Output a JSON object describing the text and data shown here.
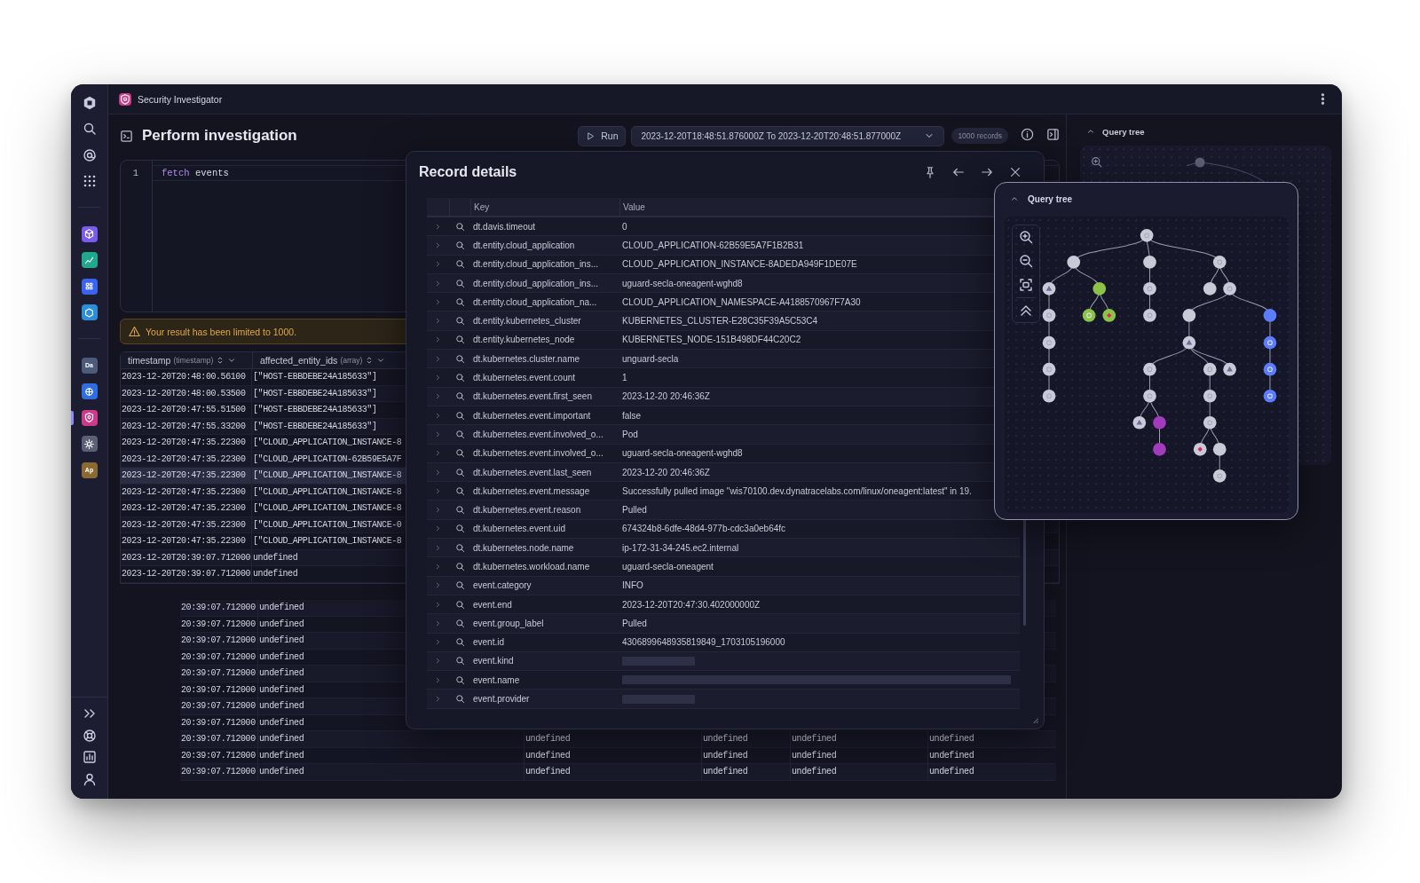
{
  "app": {
    "title": "Security Investigator"
  },
  "nav": {
    "top": [
      {
        "kind": "logo",
        "selected": false
      },
      {
        "kind": "search",
        "selected": false
      },
      {
        "kind": "at",
        "selected": false
      },
      {
        "kind": "grid",
        "selected": false
      }
    ],
    "apps": [
      {
        "kind": "cube",
        "color": "#7a5cf0",
        "selected": false
      },
      {
        "kind": "chart",
        "color": "#1fa88c",
        "selected": false
      },
      {
        "kind": "tiles",
        "color": "#3b63f0",
        "selected": false
      },
      {
        "kind": "hexagon",
        "color": "#2a8fd8",
        "selected": false
      }
    ],
    "pinned": [
      {
        "kind": "label",
        "label": "Da",
        "color": "#4d5b7a",
        "selected": false
      },
      {
        "kind": "wheel",
        "color": "#2f6de0",
        "selected": false
      },
      {
        "kind": "shield",
        "color": "#d0388a",
        "selected": true
      },
      {
        "kind": "gear",
        "color": "#5c5f78",
        "selected": false
      },
      {
        "kind": "label",
        "label": "Ap",
        "color": "#8a6a30",
        "selected": false
      }
    ],
    "bottom": [
      {
        "kind": "expand",
        "selected": false
      },
      {
        "kind": "lifebuoy",
        "selected": false
      },
      {
        "kind": "report",
        "selected": false
      },
      {
        "kind": "user",
        "selected": false
      }
    ]
  },
  "header": {
    "title": "Perform investigation",
    "run_label": "Run",
    "timeframe": "2023-12-20T18:48:51.876000Z To 2023-12-20T20:48:51.877000Z",
    "records": "1000 records"
  },
  "editor": {
    "lines": [
      {
        "number": "1",
        "tokens": [
          {
            "text": "fetch",
            "kind": "keyword"
          },
          {
            "text": "events",
            "kind": "plain"
          }
        ]
      }
    ]
  },
  "warning": "Your result has been limited to 1000.",
  "results": {
    "columns": [
      {
        "name": "timestamp",
        "type": "(timestamp)"
      },
      {
        "name": "affected_entity_ids",
        "type": "(array)"
      }
    ],
    "rows": [
      {
        "kind": "full",
        "selected": false,
        "cells": [
          "2023-12-20T20:48:00.56100",
          "[\"HOST-EBBDEBE24A185633\"]"
        ]
      },
      {
        "kind": "full",
        "selected": false,
        "cells": [
          "2023-12-20T20:48:00.53500",
          "[\"HOST-EBBDEBE24A185633\"]"
        ]
      },
      {
        "kind": "full",
        "selected": false,
        "cells": [
          "2023-12-20T20:47:55.51500",
          "[\"HOST-EBBDEBE24A185633\"]"
        ]
      },
      {
        "kind": "full",
        "selected": false,
        "cells": [
          "2023-12-20T20:47:55.33200",
          "[\"HOST-EBBDEBE24A185633\"]"
        ]
      },
      {
        "kind": "full",
        "selected": false,
        "cells": [
          "2023-12-20T20:47:35.22300",
          "[\"CLOUD_APPLICATION_INSTANCE-8"
        ]
      },
      {
        "kind": "full",
        "selected": false,
        "cells": [
          "2023-12-20T20:47:35.22300",
          "[\"CLOUD_APPLICATION-62B59E5A7F"
        ]
      },
      {
        "kind": "full",
        "selected": true,
        "cells": [
          "2023-12-20T20:47:35.22300",
          "[\"CLOUD_APPLICATION_INSTANCE-8"
        ]
      },
      {
        "kind": "full",
        "selected": false,
        "cells": [
          "2023-12-20T20:47:35.22300",
          "[\"CLOUD_APPLICATION_INSTANCE-8"
        ]
      },
      {
        "kind": "full",
        "selected": false,
        "cells": [
          "2023-12-20T20:47:35.22300",
          "[\"CLOUD_APPLICATION_INSTANCE-8"
        ]
      },
      {
        "kind": "full",
        "selected": false,
        "cells": [
          "2023-12-20T20:47:35.22300",
          "[\"CLOUD_APPLICATION_INSTANCE-0"
        ]
      },
      {
        "kind": "full",
        "selected": false,
        "cells": [
          "2023-12-20T20:47:35.22300",
          "[\"CLOUD_APPLICATION_INSTANCE-8"
        ]
      },
      {
        "kind": "full",
        "selected": false,
        "cells": [
          "2023-12-20T20:39:07.712000",
          "undefined"
        ]
      },
      {
        "kind": "full",
        "selected": false,
        "cells": [
          "2023-12-20T20:39:07.712000",
          "undefined"
        ]
      },
      {
        "kind": "shifted",
        "selected": false,
        "cells": [
          "20:39:07.712000",
          "undefined"
        ]
      },
      {
        "kind": "shifted",
        "selected": false,
        "cells": [
          "20:39:07.712000",
          "undefined"
        ]
      },
      {
        "kind": "shifted",
        "selected": false,
        "cells": [
          "20:39:07.712000",
          "undefined"
        ]
      },
      {
        "kind": "shifted",
        "selected": false,
        "cells": [
          "20:39:07.712000",
          "undefined"
        ]
      },
      {
        "kind": "shifted",
        "selected": false,
        "cells": [
          "20:39:07.712000",
          "undefined"
        ]
      },
      {
        "kind": "shifted",
        "selected": false,
        "cells": [
          "20:39:07.712000",
          "undefined"
        ]
      },
      {
        "kind": "shifted",
        "selected": false,
        "cells": [
          "20:39:07.712000",
          "undefined"
        ]
      },
      {
        "kind": "shifted",
        "selected": false,
        "cells": [
          "20:39:07.712000",
          "undefined"
        ]
      },
      {
        "kind": "shifted",
        "selected": false,
        "cells": [
          "20:39:07.712000",
          "undefined",
          "undefined",
          "undefined",
          "undefined",
          "undefined"
        ]
      },
      {
        "kind": "shifted",
        "selected": false,
        "cells": [
          "20:39:07.712000",
          "undefined",
          "undefined",
          "undefined",
          "undefined",
          "undefined"
        ]
      },
      {
        "kind": "shifted",
        "selected": false,
        "cells": [
          "20:39:07.712000",
          "undefined",
          "undefined",
          "undefined",
          "undefined",
          "undefined"
        ]
      }
    ]
  },
  "record_details": {
    "title": "Record details",
    "columns": [
      "Key",
      "Value"
    ],
    "rows": [
      {
        "key": "dt.davis.timeout",
        "value": "0"
      },
      {
        "key": "dt.entity.cloud_application",
        "value": "CLOUD_APPLICATION-62B59E5A7F1B2B31"
      },
      {
        "key": "dt.entity.cloud_application_ins...",
        "value": "CLOUD_APPLICATION_INSTANCE-8ADEDA949F1DE07E"
      },
      {
        "key": "dt.entity.cloud_application_ins...",
        "value": "uguard-secla-oneagent-wghd8"
      },
      {
        "key": "dt.entity.cloud_application_na...",
        "value": "CLOUD_APPLICATION_NAMESPACE-A4188570967F7A30"
      },
      {
        "key": "dt.entity.kubernetes_cluster",
        "value": "KUBERNETES_CLUSTER-E28C35F39A5C53C4"
      },
      {
        "key": "dt.entity.kubernetes_node",
        "value": "KUBERNETES_NODE-151B498DF44C20C2"
      },
      {
        "key": "dt.kubernetes.cluster.name",
        "value": "unguard-secla"
      },
      {
        "key": "dt.kubernetes.event.count",
        "value": "1"
      },
      {
        "key": "dt.kubernetes.event.first_seen",
        "value": "2023-12-20 20:46:36Z"
      },
      {
        "key": "dt.kubernetes.event.important",
        "value": "false"
      },
      {
        "key": "dt.kubernetes.event.involved_o...",
        "value": "Pod"
      },
      {
        "key": "dt.kubernetes.event.involved_o...",
        "value": "uguard-secla-oneagent-wghd8"
      },
      {
        "key": "dt.kubernetes.event.last_seen",
        "value": "2023-12-20 20:46:36Z"
      },
      {
        "key": "dt.kubernetes.event.message",
        "value": "Successfully pulled image \"wis70100.dev.dynatracelabs.com/linux/oneagent:latest\" in 19."
      },
      {
        "key": "dt.kubernetes.event.reason",
        "value": "Pulled"
      },
      {
        "key": "dt.kubernetes.event.uid",
        "value": "674324b8-6dfe-48d4-977b-cdc3a0eb64fc"
      },
      {
        "key": "dt.kubernetes.node.name",
        "value": "ip-172-31-34-245.ec2.internal"
      },
      {
        "key": "dt.kubernetes.workload.name",
        "value": "uguard-secla-oneagent"
      },
      {
        "key": "event.category",
        "value": "INFO"
      },
      {
        "key": "event.end",
        "value": "2023-12-20T20:47:30.402000000Z"
      },
      {
        "key": "event.group_label",
        "value": "Pulled"
      },
      {
        "key": "event.id",
        "value": "4306899648935819849_1703105196000"
      },
      {
        "key": "event.kind",
        "kind": "skeleton",
        "wide": false
      },
      {
        "key": "event.name",
        "kind": "skeleton",
        "wide": true
      },
      {
        "key": "event.provider",
        "kind": "skeleton",
        "wide": false
      }
    ]
  },
  "query_tree_popup": {
    "title": "Query tree"
  },
  "side_panel": {
    "title": "Query tree"
  }
}
